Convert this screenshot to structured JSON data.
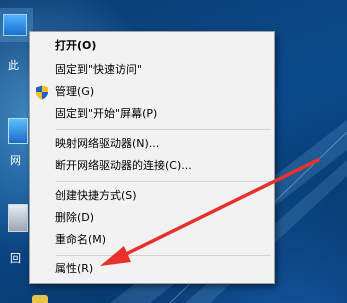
{
  "desktop": {
    "partial_label_top": "此",
    "partial_label_mid": "网",
    "partial_label_bottom": "回"
  },
  "context_menu": {
    "items": [
      {
        "label": "打开(O)"
      },
      {
        "label": "固定到\"快速访问\""
      },
      {
        "label": "管理(G)",
        "icon": "uac-shield-icon"
      },
      {
        "label": "固定到\"开始\"屏幕(P)"
      },
      {
        "label": "映射网络驱动器(N)..."
      },
      {
        "label": "断开网络驱动器的连接(C)..."
      },
      {
        "label": "创建快捷方式(S)"
      },
      {
        "label": "删除(D)"
      },
      {
        "label": "重命名(M)"
      },
      {
        "label": "属性(R)"
      }
    ]
  },
  "colors": {
    "menu_background": "#f2f2f2",
    "annotation_arrow": "#e8312a"
  }
}
